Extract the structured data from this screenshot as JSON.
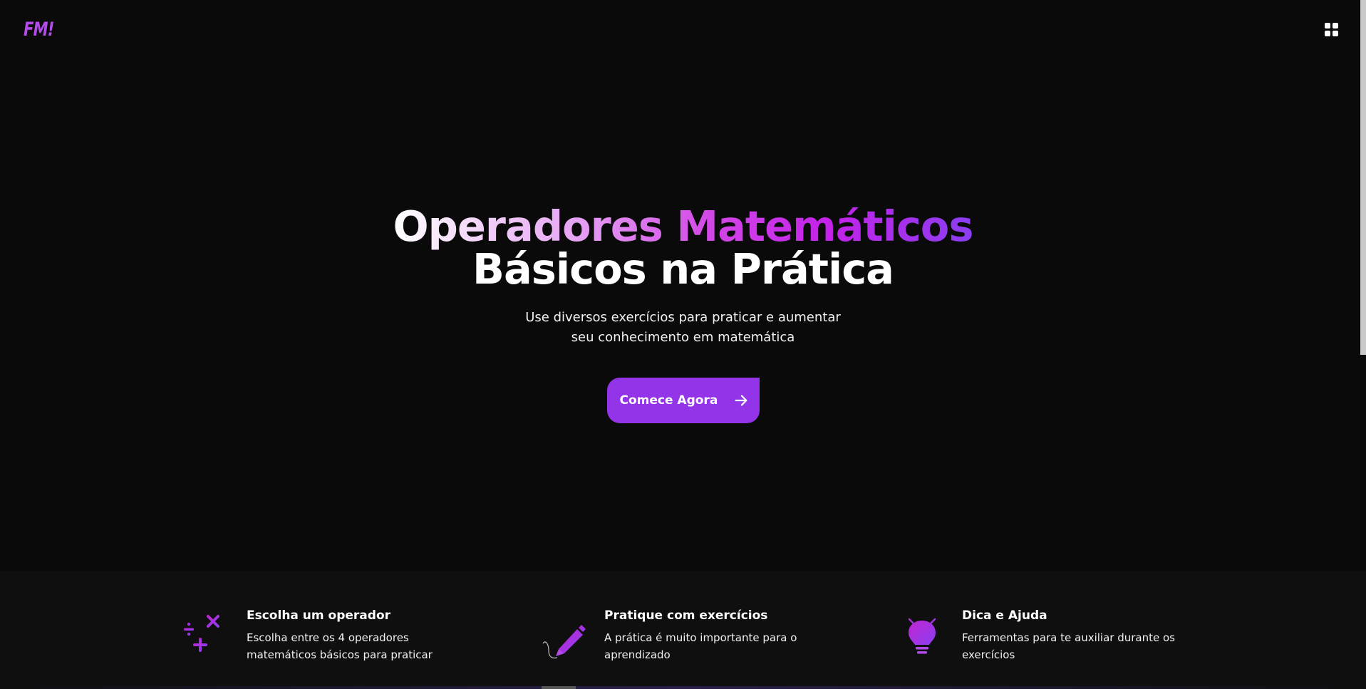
{
  "header": {
    "logo_text": "FM!",
    "menu_icon": "grid-icon"
  },
  "hero": {
    "title_gradient": "Operadores Matemáticos",
    "title_line2": "Básicos na Prática",
    "subtitle": "Use diversos exercícios para praticar e aumentar seu conhecimento em matemática",
    "cta_label": "Comece Agora",
    "cta_icon": "arrow-right-icon"
  },
  "features": [
    {
      "icon": "math-operators-icon",
      "title": "Escolha um operador",
      "description": "Escolha entre os 4 operadores matemáticos básicos para praticar"
    },
    {
      "icon": "pencil-icon",
      "title": "Pratique com exercícios",
      "description": "A prática é muito importante para o aprendizado"
    },
    {
      "icon": "lightbulb-icon",
      "title": "Dica e Ajuda",
      "description": "Ferramentas para te auxiliar durante os exercícios"
    }
  ],
  "colors": {
    "background": "#0a0a0b",
    "accent": "#9334e8",
    "logo": "#b24be8",
    "feature_band": "#0f0f10"
  }
}
